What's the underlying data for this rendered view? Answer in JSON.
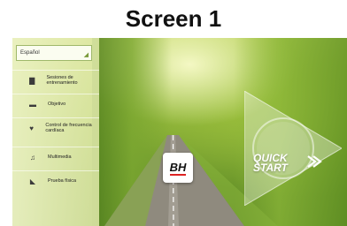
{
  "heading": "Screen 1",
  "language": {
    "selected": "Español"
  },
  "menu": [
    {
      "label": "Sesiones de entrenamiento",
      "icon": "clipboard-icon"
    },
    {
      "label": "Objetivo",
      "icon": "flag-icon"
    },
    {
      "label": "Control de frecuencia cardíaca",
      "icon": "heart-rate-icon"
    },
    {
      "label": "Multimedia",
      "icon": "music-note-icon"
    },
    {
      "label": "Prueba física",
      "icon": "fitness-test-icon"
    }
  ],
  "logo": {
    "text": "BH",
    "accent": "#d22222"
  },
  "quick_start": {
    "line1": "QUICK",
    "line2": "START",
    "color": "#ffffff"
  }
}
